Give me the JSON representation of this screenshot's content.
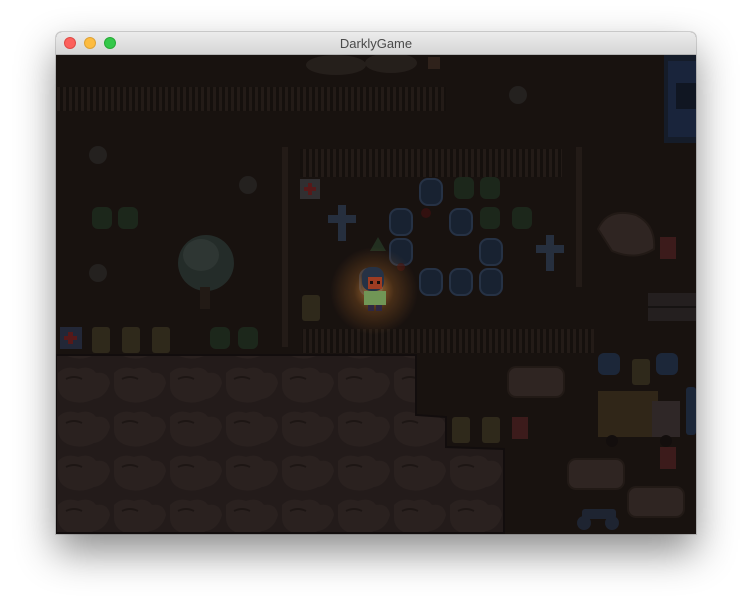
{
  "window": {
    "title": "DarklyGame"
  },
  "scene": {
    "ambient_color": "#1c1512",
    "light_color": "#ffb25a",
    "player_label": "player"
  }
}
